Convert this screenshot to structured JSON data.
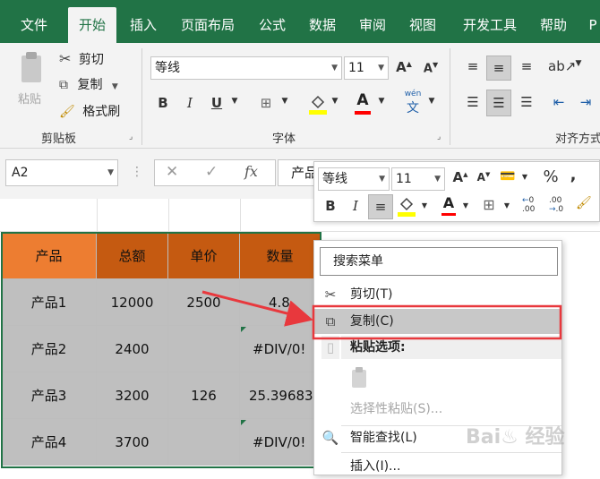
{
  "menubar": {
    "tabs": [
      "文件",
      "开始",
      "插入",
      "页面布局",
      "公式",
      "数据",
      "审阅",
      "视图",
      "开发工具",
      "帮助",
      "P"
    ],
    "active_index": 1
  },
  "ribbon": {
    "clipboard": {
      "paste_label": "粘贴",
      "cut_label": "剪切",
      "copy_label": "复制",
      "format_painter_label": "格式刷",
      "group_label": "剪贴板"
    },
    "font": {
      "font_name": "等线",
      "font_size": "11",
      "group_label": "字体",
      "bold": "B",
      "italic": "I",
      "underline": "U",
      "grow": "A",
      "shrink": "A",
      "font_color_glyph": "A",
      "phonetic_glyph": "wén"
    },
    "alignment": {
      "group_label": "对齐方式"
    }
  },
  "formula_bar": {
    "name_box": "A2",
    "fx": "fx",
    "content": "产品"
  },
  "mini_toolbar": {
    "font_name": "等线",
    "font_size": "11",
    "percent": "%",
    "comma": ",",
    "bold": "B",
    "italic": "I",
    "font_color_glyph": "A"
  },
  "sheet": {
    "headers": [
      "产品",
      "总额",
      "单价",
      "数量"
    ],
    "rows": [
      [
        "产品1",
        "12000",
        "2500",
        "4.8"
      ],
      [
        "产品2",
        "2400",
        "",
        "#DIV/0!"
      ],
      [
        "产品3",
        "3200",
        "126",
        "25.39683"
      ],
      [
        "产品4",
        "3700",
        "",
        "#DIV/0!"
      ]
    ]
  },
  "context_menu": {
    "search_placeholder": "搜索菜单",
    "cut": "剪切(T)",
    "copy": "复制(C)",
    "paste_options": "粘贴选项:",
    "paste_special": "选择性粘贴(S)...",
    "smart_lookup": "智能查找(L)",
    "insert": "插入(I)..."
  },
  "colors": {
    "excel_green": "#217346",
    "header_orange": "#ed7d31",
    "header_dark_orange": "#c55a11",
    "selection_gray": "#bfbfbf",
    "annotation_red": "#e8383d"
  }
}
